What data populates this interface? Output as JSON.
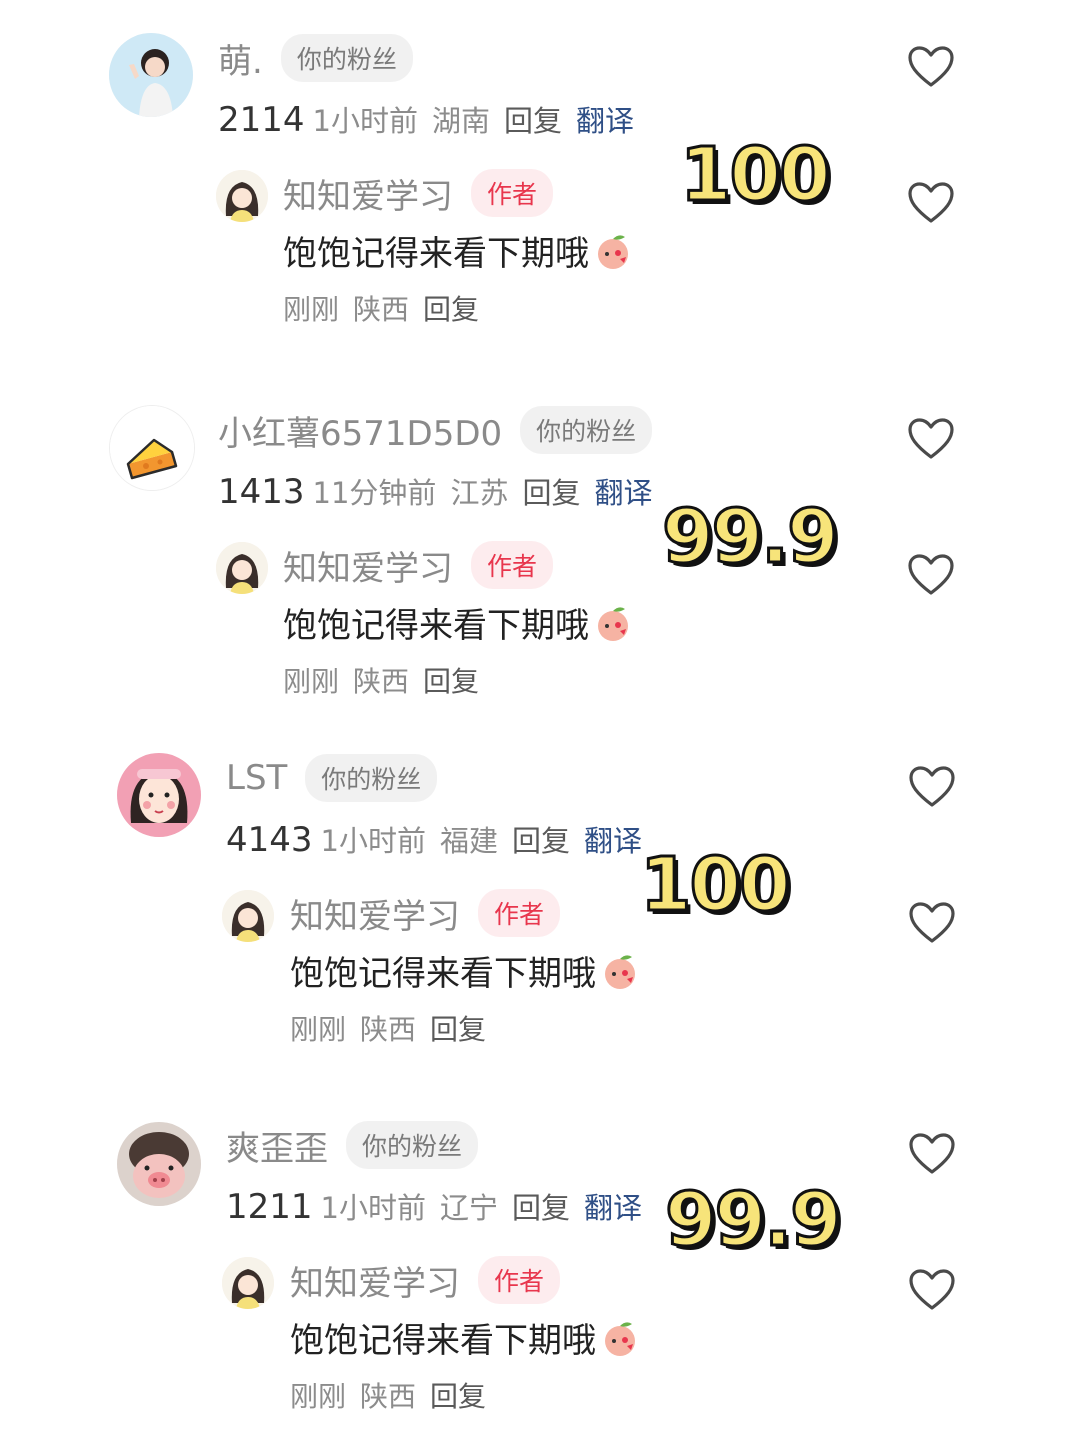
{
  "threads": [
    {
      "user": "萌.",
      "badge": "你的粉丝",
      "number": "2114",
      "time": "1小时前",
      "location": "湖南",
      "reply_label": "回复",
      "translate_label": "翻译",
      "score": "100",
      "reply": {
        "user": "知知爱学习",
        "badge": "作者",
        "text": "饱饱记得来看下期哦",
        "time": "刚刚",
        "location": "陕西",
        "reply_label": "回复"
      }
    },
    {
      "user": "小红薯6571D5D0",
      "badge": "你的粉丝",
      "number": "1413",
      "time": "11分钟前",
      "location": "江苏",
      "reply_label": "回复",
      "translate_label": "翻译",
      "score": "99.9",
      "reply": {
        "user": "知知爱学习",
        "badge": "作者",
        "text": "饱饱记得来看下期哦",
        "time": "刚刚",
        "location": "陕西",
        "reply_label": "回复"
      }
    },
    {
      "user": "LST",
      "badge": "你的粉丝",
      "number": "4143",
      "time": "1小时前",
      "location": "福建",
      "reply_label": "回复",
      "translate_label": "翻译",
      "score": "100",
      "reply": {
        "user": "知知爱学习",
        "badge": "作者",
        "text": "饱饱记得来看下期哦",
        "time": "刚刚",
        "location": "陕西",
        "reply_label": "回复"
      }
    },
    {
      "user": "爽歪歪",
      "badge": "你的粉丝",
      "number": "1211",
      "time": "1小时前",
      "location": "辽宁",
      "reply_label": "回复",
      "translate_label": "翻译",
      "score": "99.9",
      "reply": {
        "user": "知知爱学习",
        "badge": "作者",
        "text": "饱饱记得来看下期哦",
        "time": "刚刚",
        "location": "陕西",
        "reply_label": "回复"
      }
    }
  ],
  "icons": {
    "like": "heart-outline-icon",
    "emoji": "peach-emoji-icon"
  },
  "colors": {
    "score_fill": "#f7e47a",
    "author_badge": "#e8364d",
    "translate": "#2f4f86"
  }
}
